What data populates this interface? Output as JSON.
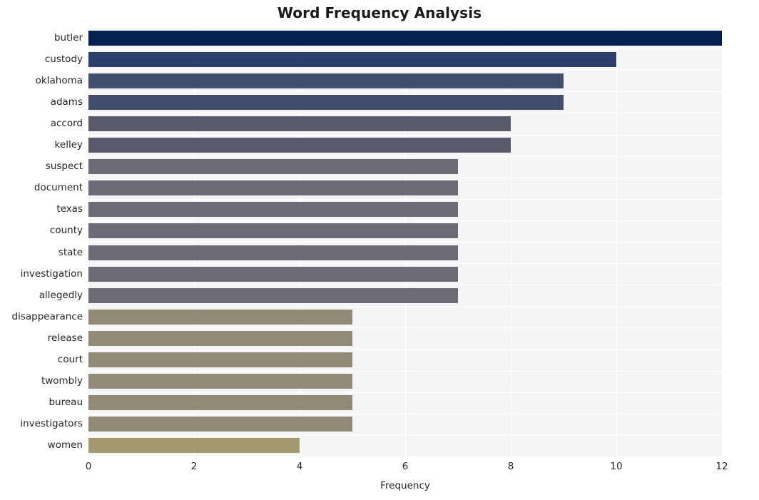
{
  "chart_data": {
    "type": "bar",
    "orientation": "horizontal",
    "title": "Word Frequency Analysis",
    "xlabel": "Frequency",
    "ylabel": "",
    "xlim": [
      0,
      12
    ],
    "xticks": [
      0,
      2,
      4,
      6,
      8,
      10,
      12
    ],
    "grid": true,
    "legend": null,
    "categories": [
      "butler",
      "custody",
      "oklahoma",
      "adams",
      "accord",
      "kelley",
      "suspect",
      "document",
      "texas",
      "county",
      "state",
      "investigation",
      "allegedly",
      "disappearance",
      "release",
      "court",
      "twombly",
      "bureau",
      "investigators",
      "women"
    ],
    "values": [
      12,
      10,
      9,
      9,
      8,
      8,
      7,
      7,
      7,
      7,
      7,
      7,
      7,
      5,
      5,
      5,
      5,
      5,
      5,
      4
    ],
    "bar_colors": [
      "#032252",
      "#2c3e6b",
      "#434d6d",
      "#434d6d",
      "#565a6b",
      "#565a6b",
      "#6a6b74",
      "#6a6b74",
      "#6a6b74",
      "#6a6b74",
      "#6a6b74",
      "#6a6b74",
      "#6a6b74",
      "#908a76",
      "#908a76",
      "#908a76",
      "#908a76",
      "#908a76",
      "#908a76",
      "#a39a70"
    ],
    "plot_background": "#f5f5f7",
    "gridline_color": "#ffffff",
    "figure_background": "#ffffff",
    "text_color": "#262626"
  }
}
